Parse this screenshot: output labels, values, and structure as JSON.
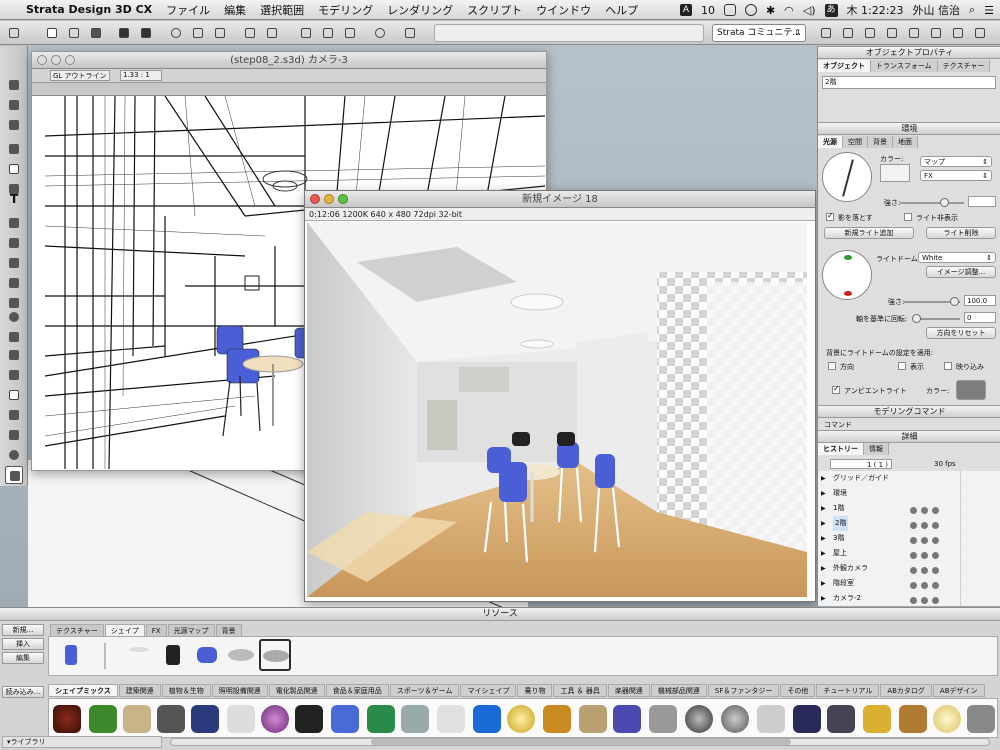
{
  "menubar": {
    "app": "Strata Design 3D CX",
    "items": [
      "ファイル",
      "編集",
      "選択範囲",
      "モデリング",
      "レンダリング",
      "スクリプト",
      "ウインドウ",
      "ヘルプ"
    ],
    "input_badge": "A",
    "battery_value": "10",
    "ime": "あ",
    "clock": "木 1:22:23",
    "user": "外山 信治"
  },
  "toolbar": {
    "community_select": "Strata コミュニテ..."
  },
  "model_window": {
    "title": "(step08_2.s3d) カメラ-3",
    "mode": "GL アウトライン",
    "scale": "1.33 : 1"
  },
  "render_window": {
    "title": "新規イメージ 18",
    "info": "0:12:06  1200K  640 x 480  72dpi  32-bit"
  },
  "object_props": {
    "title": "オブジェクトプロパティ",
    "tabs": [
      "オブジェクト",
      "トランスフォーム",
      "テクスチャー"
    ],
    "name_value": "2階"
  },
  "environment": {
    "title": "環境",
    "tabs": [
      "光源",
      "空間",
      "背景",
      "地面"
    ],
    "color_label": "カラー:",
    "map_select": "マップ",
    "fx_select": "FX",
    "strength_label": "強さ:",
    "shadow_label": "影を落とす",
    "light_hide_label": "ライト非表示",
    "add_light": "新規ライト追加",
    "delete_light": "ライト削除",
    "dome_label": "ライトドーム:",
    "dome_select": "White",
    "image_adjust": "イメージ調整...",
    "strength2_label": "強さ:",
    "strength2_value": "100.0",
    "rotate_label": "軸を基準に回転:",
    "rotate_value": "0",
    "reset_dir": "方向をリセット",
    "apply_label": "背景にライトドームの設定を適用:",
    "opt_dir": "方向",
    "opt_show": "表示",
    "opt_reflect": "映り込み",
    "ambient_label": "アンビエントライト",
    "ambient_color_label": "カラー:"
  },
  "modeling_cmd": {
    "title": "モデリングコマンド",
    "command_label": "コマンド"
  },
  "detail": {
    "title": "詳細",
    "tabs": [
      "ヒストリー",
      "情報"
    ],
    "frame_value": "1 ( 1 )",
    "fps": "30 fps",
    "rows": [
      "グリッド／ガイド",
      "環境",
      "1階",
      "2階",
      "3階",
      "屋上",
      "外観カメラ",
      "階段室",
      "カメラ-2"
    ]
  },
  "resources": {
    "title": "リソース",
    "buttons": [
      "新規...",
      "挿入",
      "編集",
      "読み込み..."
    ],
    "tabs": [
      "テクスチャー",
      "シェイプ",
      "FX",
      "光源マップ",
      "背景"
    ],
    "categories": [
      "シェイプミックス",
      "建築関連",
      "植物＆生物",
      "照明設備関連",
      "電化製品関連",
      "食品＆家庭用品",
      "スポーツ＆ゲーム",
      "マイシェイプ",
      "乗り物",
      "工具 ＆ 器具",
      "楽器関連",
      "機械部品関連",
      "SF＆ファンタジー",
      "その他",
      "チュートリアル",
      "ABカタログ",
      "ABデザイン"
    ],
    "library": "ライブラリ"
  },
  "colors": {
    "accent_red": "#e6574f",
    "accent_yellow": "#e3b43f",
    "accent_green": "#5ec33f",
    "chair_blue": "#4a5fd6",
    "floor": "#d9b27a"
  }
}
